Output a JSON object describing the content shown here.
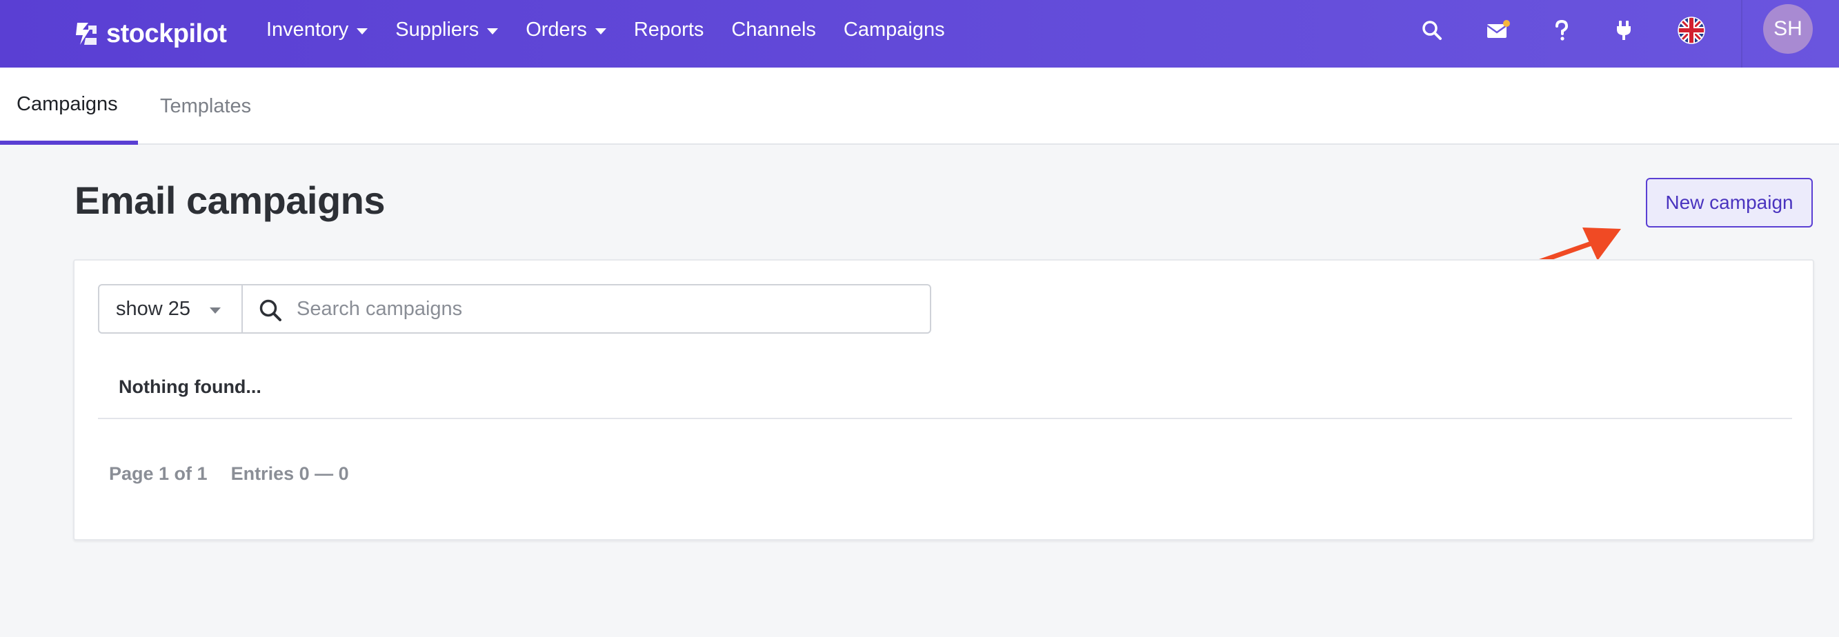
{
  "app": {
    "name": "stockpilot"
  },
  "nav": [
    {
      "label": "Inventory",
      "dropdown": true
    },
    {
      "label": "Suppliers",
      "dropdown": true
    },
    {
      "label": "Orders",
      "dropdown": true
    },
    {
      "label": "Reports",
      "dropdown": false
    },
    {
      "label": "Channels",
      "dropdown": false
    },
    {
      "label": "Campaigns",
      "dropdown": false
    }
  ],
  "topbar": {
    "icons": [
      "search-icon",
      "mail-icon",
      "help-icon",
      "plug-icon",
      "uk-flag-icon"
    ],
    "notification_dot_color": "#f6b73c",
    "avatar_initials": "SH"
  },
  "tabs": [
    {
      "label": "Campaigns",
      "active": true
    },
    {
      "label": "Templates",
      "active": false
    }
  ],
  "page": {
    "title": "Email campaigns",
    "new_button_label": "New campaign"
  },
  "filters": {
    "page_size_label": "show 25",
    "search_placeholder": "Search campaigns",
    "search_value": ""
  },
  "results": {
    "empty_message": "Nothing found...",
    "page_info": "Page 1 of 1",
    "entries_info": "Entries 0 — 0"
  },
  "colors": {
    "brand": "#5a3fd3",
    "annotation_arrow": "#f04a24"
  }
}
